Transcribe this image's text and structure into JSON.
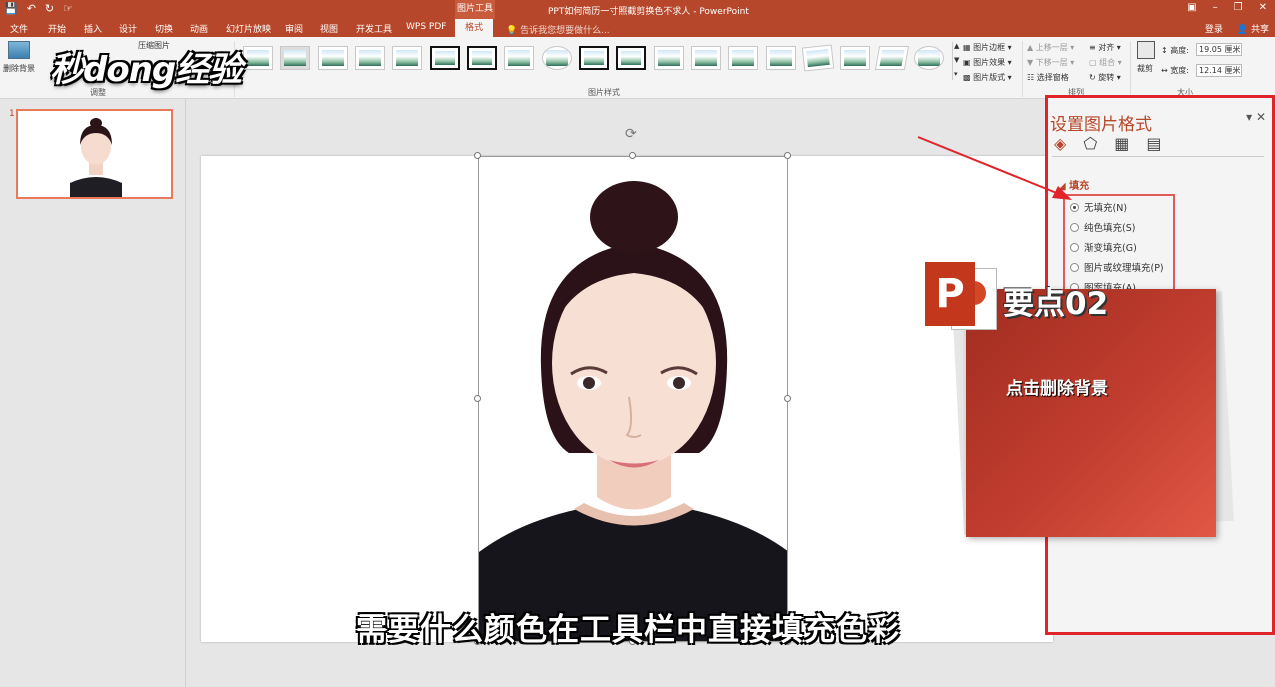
{
  "titlebar": {
    "context_label": "图片工具",
    "doc_title": "PPT如何简历一寸照截剪换色不求人 - PowerPoint",
    "qat": [
      "save-icon",
      "undo-icon",
      "redo-icon",
      "touch-icon"
    ]
  },
  "tabs": {
    "items": [
      "文件",
      "开始",
      "插入",
      "设计",
      "切换",
      "动画",
      "幻灯片放映",
      "审阅",
      "视图",
      "开发工具",
      "WPS PDF",
      "格式"
    ],
    "active": "格式",
    "tell_me": "告诉我您想要做什么...",
    "login": "登录",
    "share": "共享"
  },
  "ribbon": {
    "remove_bg": "删除背景",
    "compress": "压缩图片",
    "group_adjust": "调整",
    "group_styles": "图片样式",
    "group_arrange": "排列",
    "group_size": "大小",
    "picture_border": "图片边框",
    "picture_effects": "图片效果",
    "picture_layout": "图片版式",
    "bring_forward": "上移一层",
    "send_backward": "下移一层",
    "selection_pane": "选择窗格",
    "align": "对齐",
    "group": "组合",
    "rotate": "旋转",
    "crop": "裁剪",
    "height_label": "高度:",
    "height_value": "19.05 厘米",
    "width_label": "宽度:",
    "width_value": "12.14 厘米"
  },
  "logo_text": "秒dong经验",
  "thumbnails": {
    "slide_number": "1"
  },
  "format_pane": {
    "title": "设置图片格式",
    "section": "填充",
    "options": [
      "无填充(N)",
      "纯色填充(S)",
      "渐变填充(G)",
      "图片或纹理填充(P)",
      "图案填充(A)"
    ],
    "selected_index": 0
  },
  "overlay": {
    "keypoint": "要点02",
    "message": "点击删除背景",
    "badge": "P"
  },
  "subtitle": "需要什么颜色在工具栏中直接填充色彩",
  "colors": {
    "accent": "#b7472a",
    "highlight": "#e0242a",
    "card": "#c13d2f"
  }
}
